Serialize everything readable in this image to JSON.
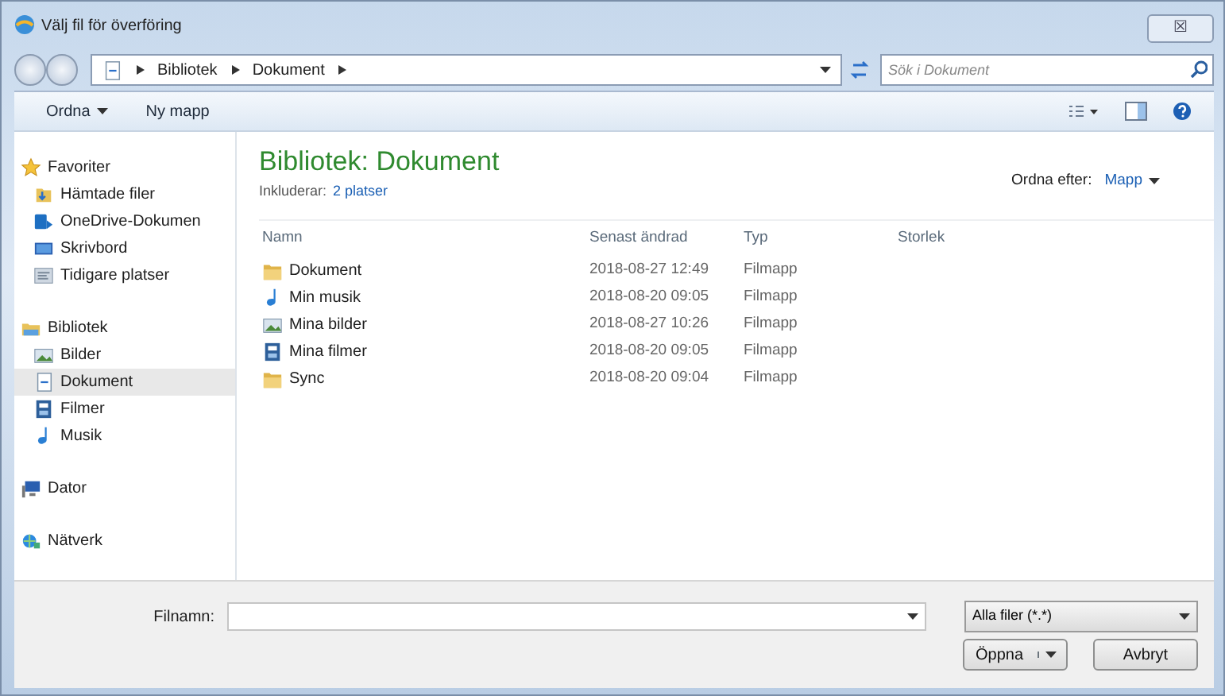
{
  "window": {
    "title": "Välj fil för överföring",
    "close": "☒"
  },
  "address": {
    "crumbs": [
      "Bibliotek",
      "Dokument"
    ],
    "search_placeholder": "Sök i Dokument"
  },
  "toolbar": {
    "organize": "Ordna",
    "new_folder": "Ny mapp"
  },
  "sidebar": {
    "groups": [
      {
        "label": "Favoriter",
        "items": [
          {
            "label": "Hämtade filer",
            "selected": false
          },
          {
            "label": "OneDrive-Dokumen",
            "selected": false
          },
          {
            "label": "Skrivbord",
            "selected": false
          },
          {
            "label": "Tidigare platser",
            "selected": false
          }
        ]
      },
      {
        "label": "Bibliotek",
        "items": [
          {
            "label": "Bilder",
            "selected": false
          },
          {
            "label": "Dokument",
            "selected": true
          },
          {
            "label": "Filmer",
            "selected": false
          },
          {
            "label": "Musik",
            "selected": false
          }
        ]
      },
      {
        "label": "Dator"
      },
      {
        "label": "Nätverk"
      }
    ]
  },
  "library": {
    "title": "Bibliotek: Dokument",
    "includes_label": "Inkluderar:",
    "includes_link": "2 platser",
    "arrange_label": "Ordna efter:",
    "arrange_value": "Mapp"
  },
  "table": {
    "columns": [
      "Namn",
      "Senast ändrad",
      "Typ",
      "Storlek"
    ],
    "rows": [
      {
        "name": "Dokument",
        "modified": "2018-08-27 12:49",
        "type": "Filmapp"
      },
      {
        "name": "Min musik",
        "modified": "2018-08-20 09:05",
        "type": "Filmapp"
      },
      {
        "name": "Mina bilder",
        "modified": "2018-08-27 10:26",
        "type": "Filmapp"
      },
      {
        "name": "Mina filmer",
        "modified": "2018-08-20 09:05",
        "type": "Filmapp"
      },
      {
        "name": "Sync",
        "modified": "2018-08-20 09:04",
        "type": "Filmapp"
      }
    ]
  },
  "footer": {
    "filename_label": "Filnamn:",
    "filter": "Alla filer (*.*)",
    "open": "Öppna",
    "cancel": "Avbryt"
  }
}
